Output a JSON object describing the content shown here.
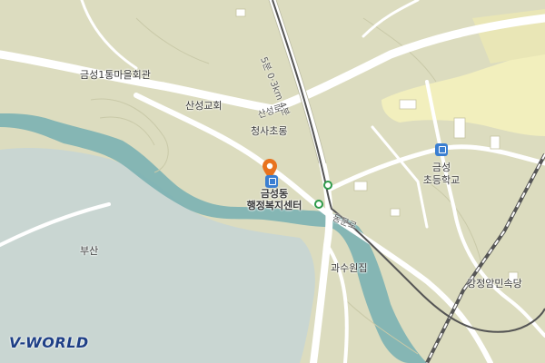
{
  "map": {
    "brand": "V-WORLD",
    "labels": {
      "village_hall": "금성1통마을회관",
      "church": "산성교회",
      "road_sanseong": "산성로",
      "school_area": "청사초롱",
      "poi_line1": "금성동",
      "poi_line2": "행정복지센터",
      "busan": "부산",
      "gwasu": "과수원집",
      "school_line1": "금성",
      "school_line2": "초등학교",
      "restaurant": "강정암민속당",
      "road_north": "5분 0·3km 4분",
      "road_east": "동문로"
    },
    "colors": {
      "land": "#dcdcbf",
      "water": "#c9d6d2",
      "river": "#7fb3b3",
      "road": "#ffffff",
      "railway": "#555555",
      "school_zone": "#f2efbd",
      "poi": "#3b7fd1",
      "pin": "#e8731e",
      "station": "#2e9a4a"
    },
    "icons": [
      "location-pin-icon",
      "public-office-icon",
      "school-icon",
      "subway-station-icon"
    ]
  }
}
